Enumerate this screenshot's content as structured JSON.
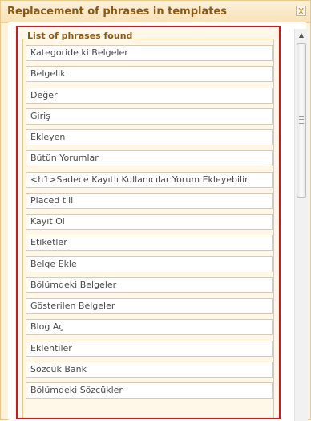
{
  "dialog": {
    "title": "Replacement of phrases in templates",
    "close_label": "X"
  },
  "fieldset": {
    "legend": "List of phrases found"
  },
  "phrases": [
    "Kategoride ki Belgeler",
    "Belgelik",
    "Değer",
    "Giriş",
    "Ekleyen",
    "Bütün Yorumlar",
    "<h1>Sadece Kayıtlı Kullanıcılar Yorum Ekleyebilir",
    "Placed till",
    "Kayıt Ol",
    "Etiketler",
    "Belge Ekle",
    "Bölümdeki Belgeler",
    "Gösterilen Belgeler",
    "Blog Aç",
    "Eklentiler",
    "Sözcük Bank",
    "Bölümdeki Sözcükler"
  ],
  "scrollbar": {
    "up_arrow_icon": "triangle-up-icon",
    "grip_icon": "grip-icon",
    "position_fraction": 0
  },
  "colors": {
    "title_text": "#8a5a14",
    "highlight_border": "#e0101d",
    "dialog_background": "#fdf3df"
  }
}
